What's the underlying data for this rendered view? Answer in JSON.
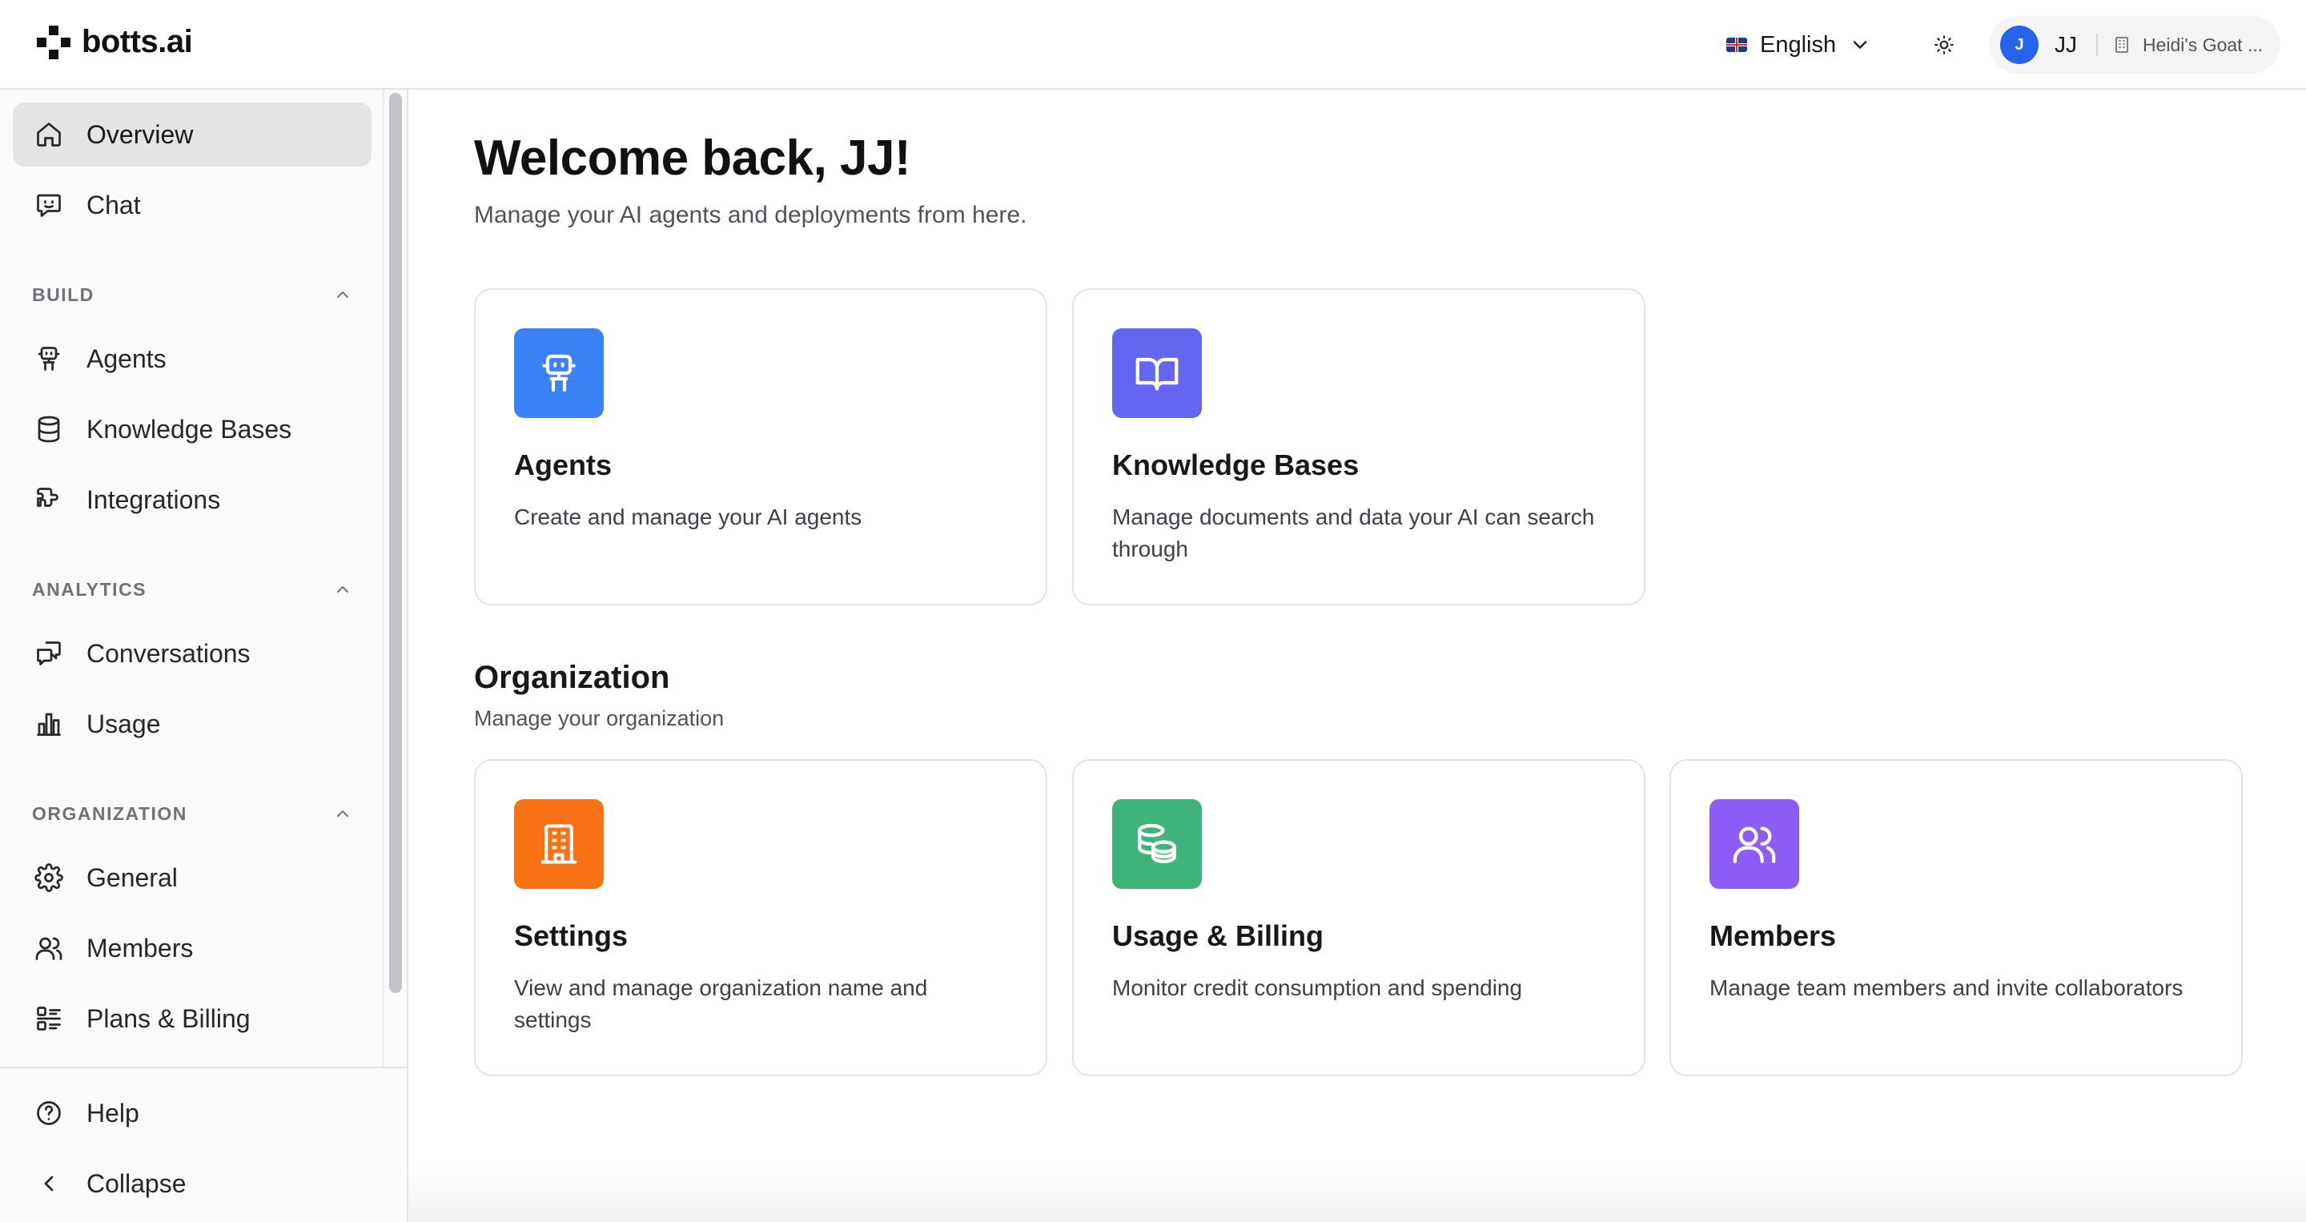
{
  "app": {
    "name": "botts.ai"
  },
  "header": {
    "language": "English",
    "account": {
      "avatar_letter": "J",
      "initials": "JJ",
      "org_name": "Heidi's Goat ..."
    }
  },
  "sidebar": {
    "top_items": [
      {
        "label": "Overview",
        "active": true
      },
      {
        "label": "Chat"
      }
    ],
    "sections": [
      {
        "label": "BUILD",
        "items": [
          {
            "label": "Agents"
          },
          {
            "label": "Knowledge Bases"
          },
          {
            "label": "Integrations"
          }
        ]
      },
      {
        "label": "ANALYTICS",
        "items": [
          {
            "label": "Conversations"
          },
          {
            "label": "Usage"
          }
        ]
      },
      {
        "label": "ORGANIZATION",
        "items": [
          {
            "label": "General"
          },
          {
            "label": "Members"
          },
          {
            "label": "Plans & Billing"
          }
        ]
      }
    ],
    "bottom_items": [
      {
        "label": "Help"
      },
      {
        "label": "Collapse"
      }
    ]
  },
  "main": {
    "title": "Welcome back, JJ!",
    "subtitle": "Manage your AI agents and deployments from here.",
    "build_cards": [
      {
        "title": "Agents",
        "description": "Create and manage your AI agents",
        "icon": "robot-icon",
        "color": "#3b82f6"
      },
      {
        "title": "Knowledge Bases",
        "description": "Manage documents and data your AI can search through",
        "icon": "book-open-icon",
        "color": "#6366f1"
      }
    ],
    "organization": {
      "title": "Organization",
      "subtitle": "Manage your organization",
      "cards": [
        {
          "title": "Settings",
          "description": "View and manage organization name and settings",
          "icon": "building-icon",
          "color": "#f97316"
        },
        {
          "title": "Usage & Billing",
          "description": "Monitor credit consumption and spending",
          "icon": "coins-icon",
          "color": "#3fb47a"
        },
        {
          "title": "Members",
          "description": "Manage team members and invite collaborators",
          "icon": "users-icon",
          "color": "#8b5cf6"
        }
      ]
    }
  }
}
